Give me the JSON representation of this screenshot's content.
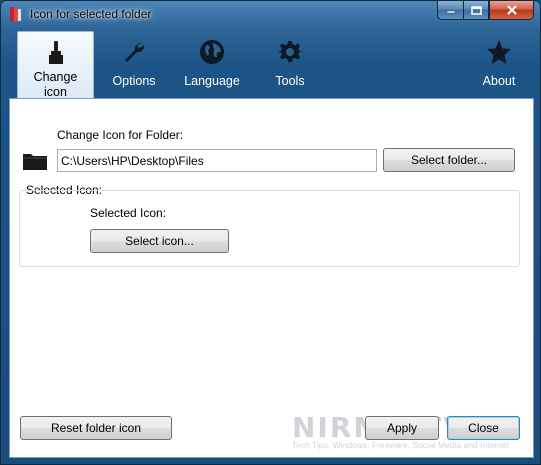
{
  "window": {
    "title": "Icon for selected folder"
  },
  "toolbar": {
    "items": [
      {
        "label": "Change icon",
        "icon": "brush-icon",
        "active": true
      },
      {
        "label": "Options",
        "icon": "wrench-icon",
        "active": false
      },
      {
        "label": "Language",
        "icon": "globe-icon",
        "active": false
      },
      {
        "label": "Tools",
        "icon": "gear-icon",
        "active": false
      },
      {
        "label": "About",
        "icon": "star-icon",
        "active": false
      }
    ]
  },
  "folder_section": {
    "heading": "Change Icon for Folder:",
    "path_value": "C:\\Users\\HP\\Desktop\\Files",
    "select_folder_label": "Select folder..."
  },
  "icon_section": {
    "group_title": "Selected Icon:",
    "label": "Selected Icon:",
    "select_icon_label": "Select icon..."
  },
  "footer": {
    "reset_label": "Reset folder icon",
    "apply_label": "Apply",
    "close_label": "Close"
  },
  "watermark": {
    "brand": "NIRMALTV",
    "tagline": "Tech Tips, Windows, Freeware, Social Media and Internet"
  },
  "colors": {
    "frame": "#1a4d7c",
    "accent": "#3c7fb1",
    "close_button": "#c4442a"
  }
}
